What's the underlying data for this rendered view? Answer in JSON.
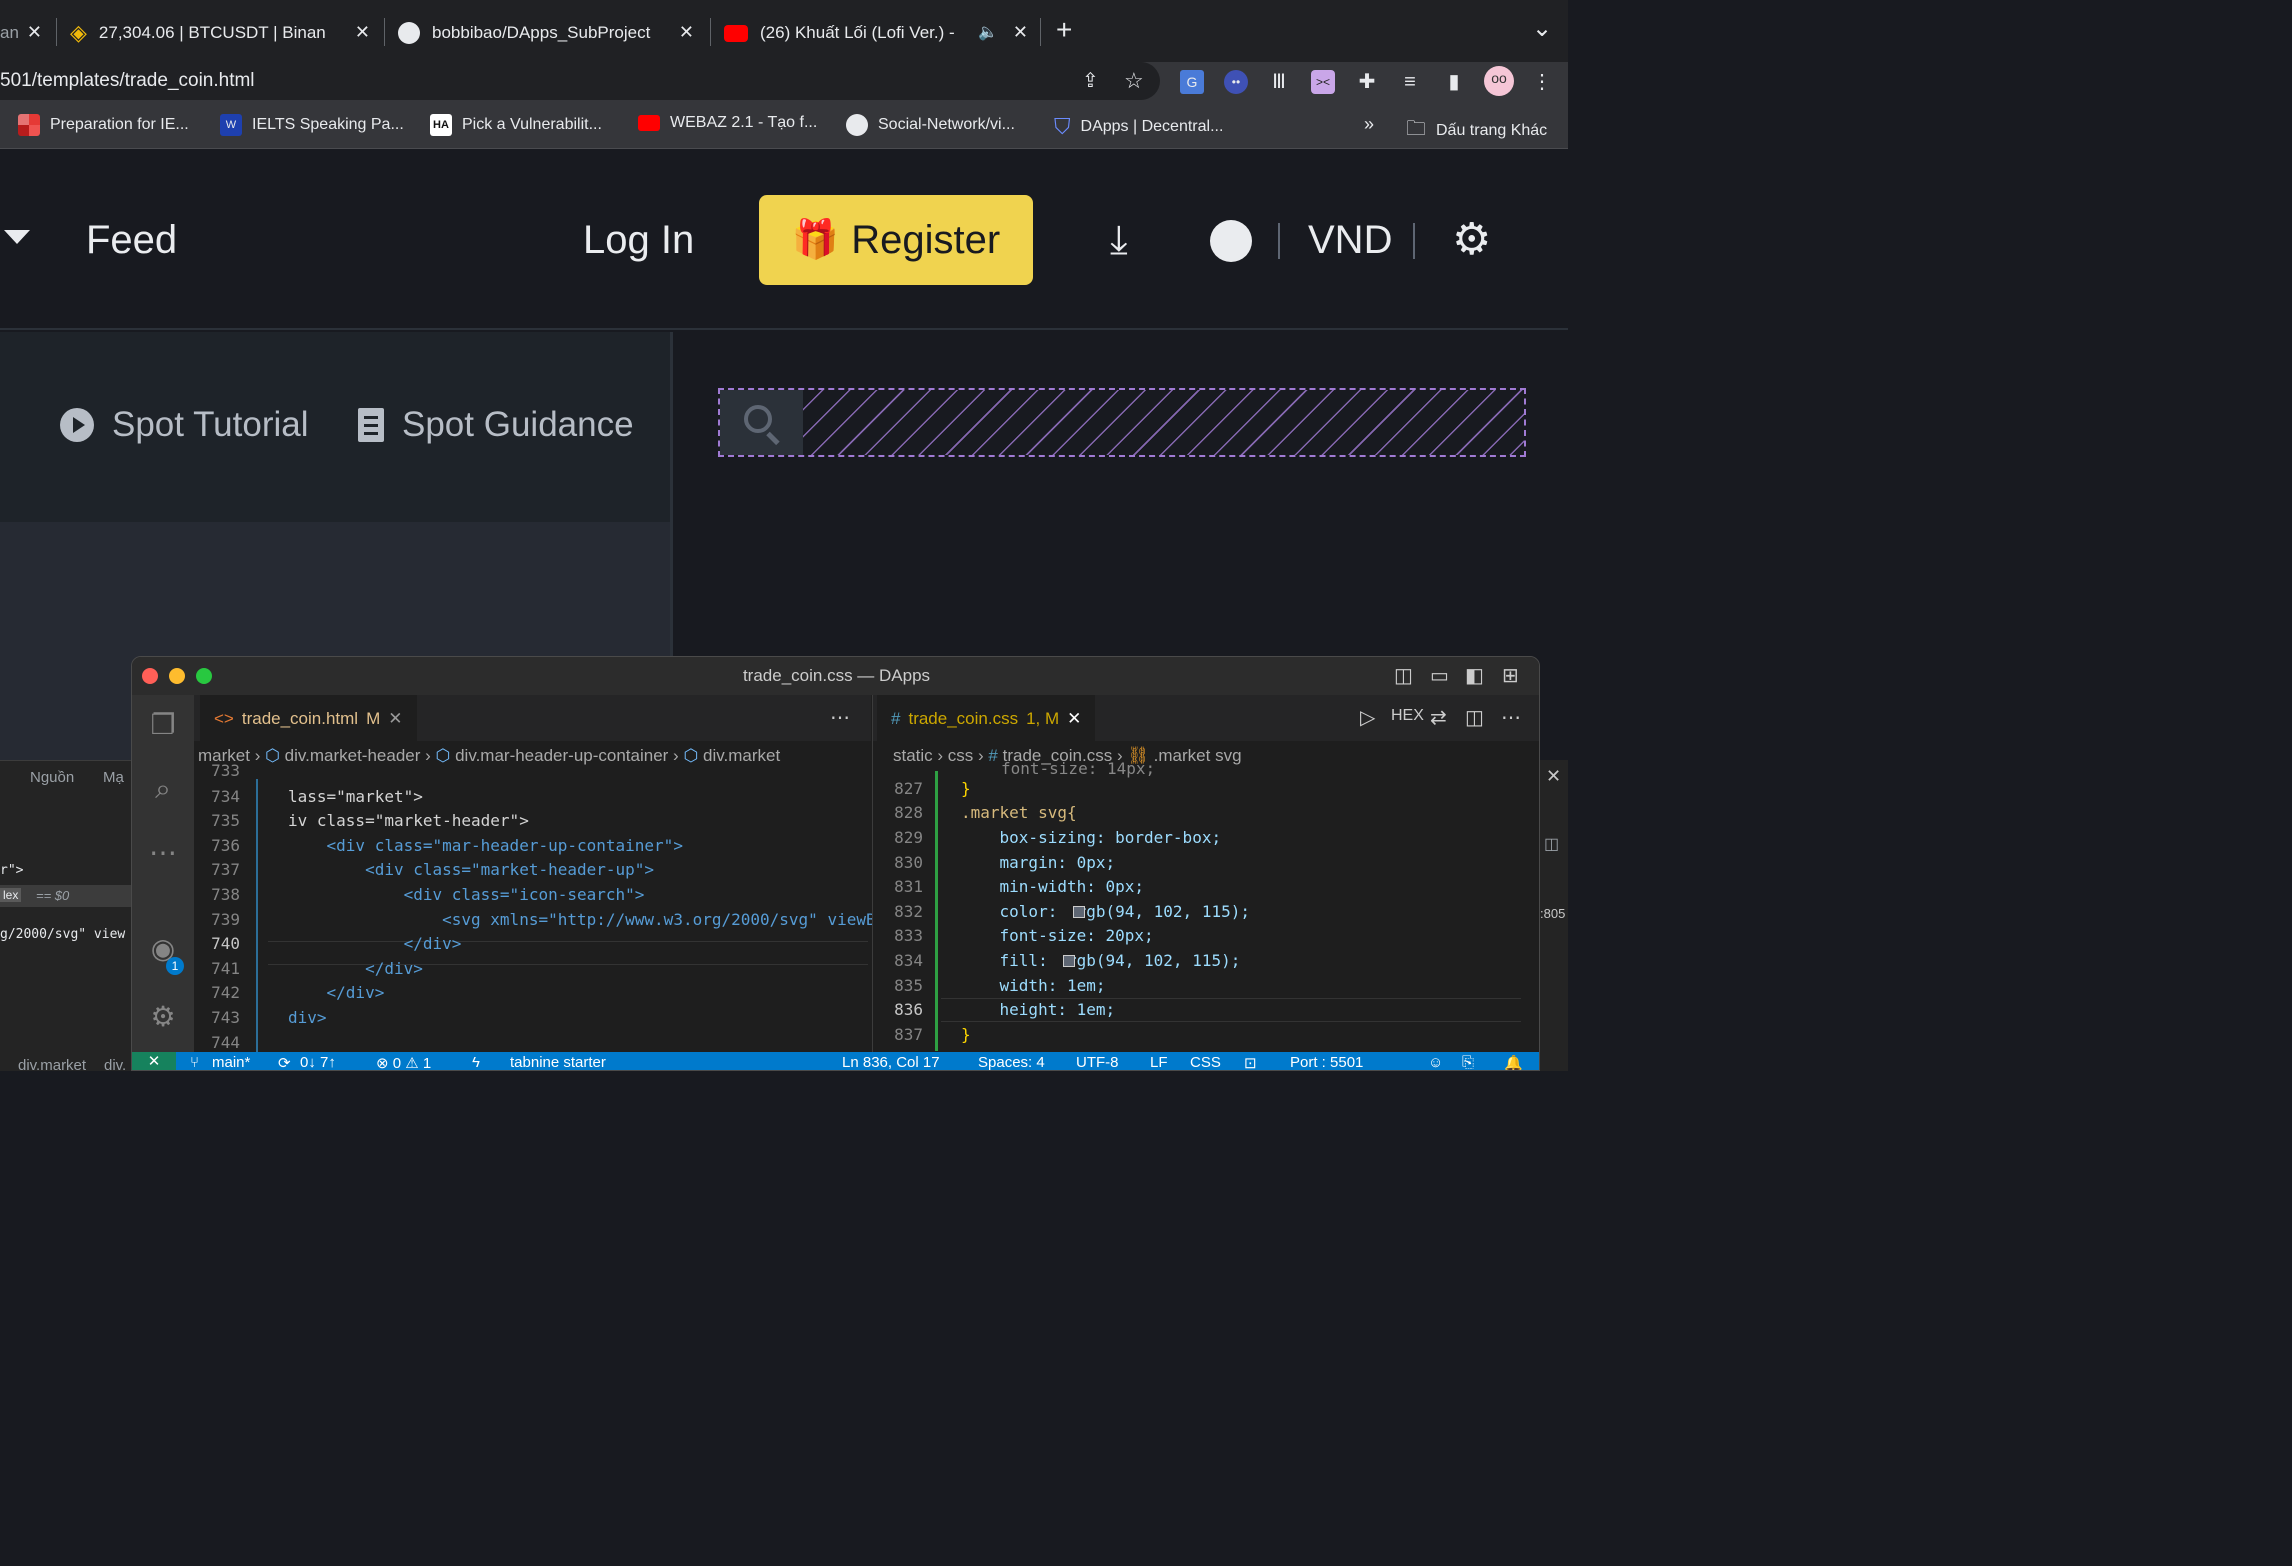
{
  "browser": {
    "tabs": [
      {
        "title": "an",
        "close": "✕"
      },
      {
        "title": "27,304.06 | BTCUSDT | Binan",
        "close": "✕"
      },
      {
        "title": "bobbibao/DApps_SubProject",
        "close": "✕"
      },
      {
        "title": "(26) Khuất Lối (Lofi Ver.) -",
        "close": "✕"
      }
    ],
    "new_tab": "+",
    "tab_menu": "⌄",
    "url": "501/templates/trade_coin.html",
    "bookmarks": [
      "Preparation for IE...",
      "IELTS Speaking Pa...",
      "Pick a Vulnerabilit...",
      "WEBAZ 2.1 - Tạo f...",
      "Social-Network/vi...",
      "DApps | Decentral..."
    ],
    "bookmarks_more": "»",
    "other_bookmarks": "Dấu trang Khác"
  },
  "site": {
    "nav_feed": "Feed",
    "login": "Log In",
    "register": "Register",
    "currency": "VND",
    "spot_tutorial": "Spot Tutorial",
    "spot_guidance": "Spot Guidance"
  },
  "devtools": {
    "tab_source": "Nguồn",
    "tab_network": "Mạ",
    "line1": "r\">",
    "line2": "lex",
    "line2b": "== $0",
    "line3": "g/2000/svg\" view",
    "footer1": "div.market",
    "footer2": "div.",
    "coord": ":805"
  },
  "vscode": {
    "title": "trade_coin.css — DApps",
    "left_tab": {
      "name": "trade_coin.html",
      "status": "M",
      "close": "✕"
    },
    "right_tab": {
      "name": "trade_coin.css",
      "status": "1, M",
      "close": "✕"
    },
    "right_tools": {
      "hex": "HEX"
    },
    "left_crumbs": [
      "market",
      "div.market-header",
      "div.mar-header-up-container",
      "div.market"
    ],
    "right_crumbs": [
      "static",
      "css",
      "trade_coin.css",
      ".market svg"
    ],
    "left_lines": [
      {
        "n": "733",
        "t": ""
      },
      {
        "n": "734",
        "t": "lass=\"market\">"
      },
      {
        "n": "735",
        "t": "iv class=\"market-header\">"
      },
      {
        "n": "736",
        "t": "    <div class=\"mar-header-up-container\">"
      },
      {
        "n": "737",
        "t": "        <div class=\"market-header-up\">"
      },
      {
        "n": "738",
        "t": "            <div class=\"icon-search\">"
      },
      {
        "n": "739",
        "t": "                <svg xmlns=\"http://www.w3.org/2000/svg\" viewB"
      },
      {
        "n": "740",
        "t": "            </div>"
      },
      {
        "n": "741",
        "t": "        </div>"
      },
      {
        "n": "742",
        "t": "    </div>"
      },
      {
        "n": "743",
        "t": "div>"
      },
      {
        "n": "744",
        "t": ""
      }
    ],
    "right_lines": [
      {
        "n": "827",
        "t": "}"
      },
      {
        "n": "828",
        "t": ".market svg{"
      },
      {
        "n": "829",
        "t": "    box-sizing: border-box;"
      },
      {
        "n": "830",
        "t": "    margin: 0px;"
      },
      {
        "n": "831",
        "t": "    min-width: 0px;"
      },
      {
        "n": "832",
        "t": "    color:  rgb(94, 102, 115);"
      },
      {
        "n": "833",
        "t": "    font-size: 20px;"
      },
      {
        "n": "834",
        "t": "    fill:  rgb(94, 102, 115);"
      },
      {
        "n": "835",
        "t": "    width: 1em;"
      },
      {
        "n": "836",
        "t": "    height: 1em;"
      },
      {
        "n": "837",
        "t": "}"
      }
    ],
    "partial_top_line": "font-size: 14px;",
    "status": {
      "branch": "main*",
      "sync": "0↓ 7↑",
      "problems": "⊗ 0 ⚠ 1",
      "tabnine": "tabnine starter",
      "position": "Ln 836, Col 17",
      "spaces": "Spaces: 4",
      "encoding": "UTF-8",
      "eol": "LF",
      "lang": "CSS",
      "port": "Port : 5501"
    },
    "accounts_badge": "1"
  },
  "colors": {
    "brand_yellow": "#f0d34f",
    "status_blue": "#007acc",
    "swatch": "#5e6673"
  }
}
